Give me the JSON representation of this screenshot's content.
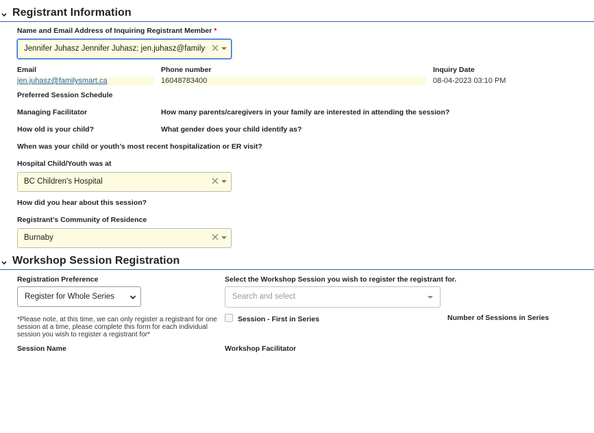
{
  "registrant": {
    "section_title": "Registrant Information",
    "inquiring_label": "Name and Email Address of Inquiring Registrant Member",
    "required_mark": "*",
    "inquiring_value": "Jennifer Juhasz Jennifer Juhasz; jen.juhasz@familys…",
    "email_label": "Email",
    "email_value": "jen.juhasz@familysmart.ca",
    "phone_label": "Phone number",
    "phone_value": "16048783400",
    "inquiry_date_label": "Inquiry Date",
    "inquiry_date_value": "08-04-2023 03:10 PM",
    "preferred_schedule_label": "Preferred Session Schedule",
    "managing_facilitator_label": "Managing Facilitator",
    "parents_count_label": "How many parents/caregivers in your family are interested in attending the session?",
    "child_age_label": "How old is your child?",
    "child_gender_label": "What gender does your child identify as?",
    "hospitalization_label": "When was your child or youth’s most recent hospitalization or ER visit?",
    "hospital_label": "Hospital Child/Youth was at",
    "hospital_value": "BC Children's Hospital",
    "heard_about_label": "How did you hear about this session?",
    "community_label": "Registrant's Community of Residence",
    "community_value": "Burnaby"
  },
  "workshop": {
    "section_title": "Workshop Session Registration",
    "preference_label": "Registration Preference",
    "preference_value": "Register for Whole Series",
    "session_select_label": "Select the Workshop Session you wish to register the registrant for.",
    "session_search_placeholder": "Search and select",
    "first_in_series_label": "Session - First in Series",
    "number_sessions_label": "Number of Sessions in Series",
    "note": "*Please note, at this time, we can only register a registrant for one session at a time, please complete this form for each individual session you wish to register a registrant for*",
    "session_name_label": "Session Name",
    "workshop_facilitator_label": "Workshop Facilitator"
  },
  "colors": {
    "accent": "#3b5ea8",
    "field_highlight": "#fdfbe0",
    "required": "#c8102e",
    "link": "#2a64b8"
  }
}
